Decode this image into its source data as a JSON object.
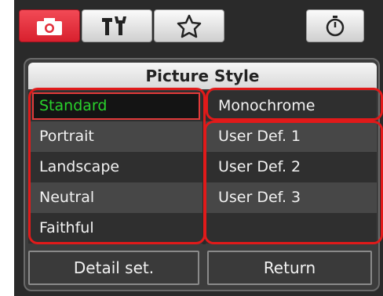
{
  "tabs": [
    {
      "icon": "camera-icon",
      "active": true
    },
    {
      "icon": "wrench-tools-icon",
      "active": false
    },
    {
      "icon": "star-icon",
      "active": false
    },
    {
      "icon": "stopwatch-icon",
      "active": false
    }
  ],
  "panel": {
    "title": "Picture Style"
  },
  "styles_left": [
    {
      "label": "Standard",
      "selected": true
    },
    {
      "label": "Portrait",
      "selected": false
    },
    {
      "label": "Landscape",
      "selected": false
    },
    {
      "label": "Neutral",
      "selected": false
    },
    {
      "label": "Faithful",
      "selected": false
    }
  ],
  "styles_right": [
    {
      "label": "Monochrome"
    },
    {
      "label": "User Def. 1"
    },
    {
      "label": "User Def. 2"
    },
    {
      "label": "User Def. 3"
    }
  ],
  "buttons": {
    "detail": "Detail  set.",
    "return": "Return"
  },
  "colors": {
    "active_tab": "#e2303c",
    "selected_text": "#29d12c",
    "highlight_outline": "#e11a1a"
  }
}
